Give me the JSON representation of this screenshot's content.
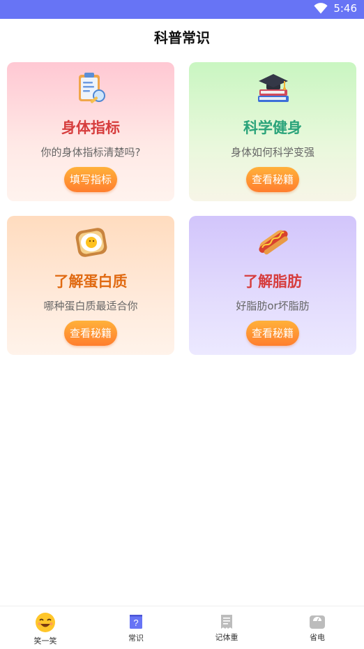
{
  "status": {
    "time": "5:46"
  },
  "page": {
    "title": "科普常识"
  },
  "cards": [
    {
      "title": "身体指标",
      "subtitle": "你的身体指标清楚吗?",
      "button": "填写指标",
      "title_color": "#d63d3d"
    },
    {
      "title": "科学健身",
      "subtitle": "身体如何科学变强",
      "button": "查看秘籍",
      "title_color": "#2aa37a"
    },
    {
      "title": "了解蛋白质",
      "subtitle": "哪种蛋白质最适合你",
      "button": "查看秘籍",
      "title_color": "#e06a12"
    },
    {
      "title": "了解脂肪",
      "subtitle": "好脂肪or坏脂肪",
      "button": "查看秘籍",
      "title_color": "#d63d3d"
    }
  ],
  "tabs": [
    {
      "label": "笑一笑",
      "icon": "smile-emoji-icon"
    },
    {
      "label": "常识",
      "icon": "question-book-icon",
      "active": true
    },
    {
      "label": "记体重",
      "icon": "receipt-icon"
    },
    {
      "label": "省电",
      "icon": "scale-icon"
    }
  ],
  "colors": {
    "status_bar": "#6774f5",
    "button": "#ff8d30",
    "tab_active": "#6774f5",
    "tab_inactive": "#bcbcbc"
  }
}
